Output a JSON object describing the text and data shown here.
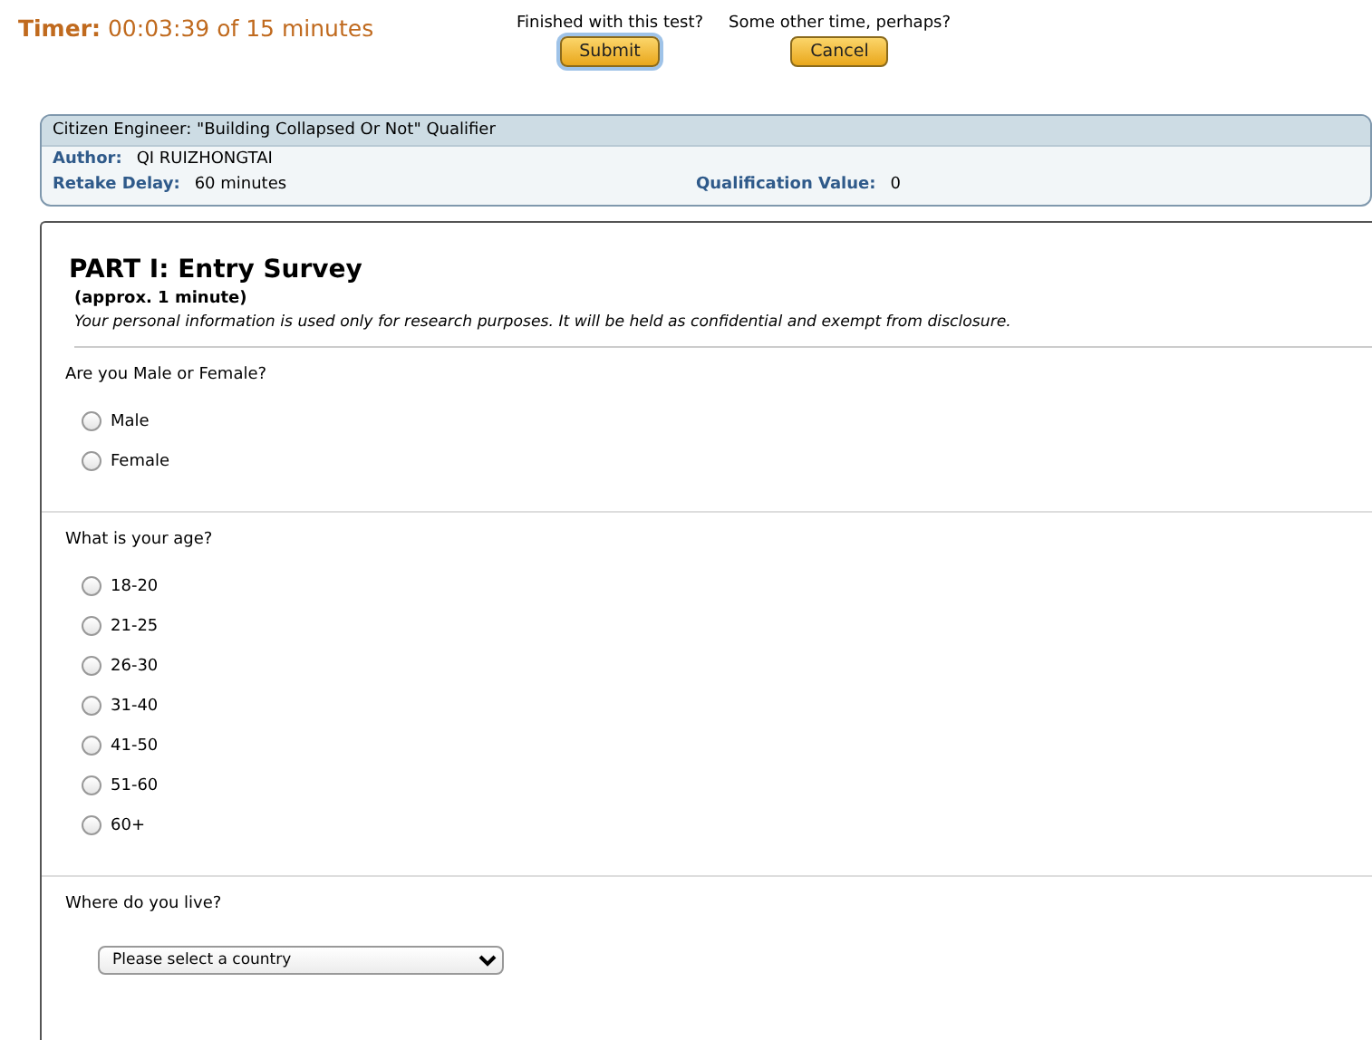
{
  "timer": {
    "label": "Timer:",
    "value": "00:03:39 of 15 minutes"
  },
  "actions": [
    {
      "prompt": "Finished with this test?",
      "button": "Submit",
      "focused": true
    },
    {
      "prompt": "Some other time, perhaps?",
      "button": "Cancel",
      "focused": false
    }
  ],
  "info": {
    "title": "Citizen Engineer: \"Building Collapsed Or Not\" Qualifier",
    "author_label": "Author:",
    "author": "QI RUIZHONGTAI",
    "delay_label": "Retake Delay:",
    "delay": "60 minutes",
    "value_label": "Qualification Value:",
    "value": "0"
  },
  "part": {
    "title": "PART I: Entry Survey",
    "duration": "(approx. 1 minute)",
    "note": "Your personal information is used only for research purposes. It will be held as confidential and exempt from disclosure."
  },
  "questions": [
    {
      "kind": "radio",
      "text": "Are you Male or Female?",
      "options": [
        {
          "label": "Male",
          "selected": false
        },
        {
          "label": "Female",
          "selected": false
        }
      ]
    },
    {
      "kind": "radio",
      "text": "What is your age?",
      "options": [
        {
          "label": "18-20",
          "selected": false
        },
        {
          "label": "21-25",
          "selected": false
        },
        {
          "label": "26-30",
          "selected": false
        },
        {
          "label": "31-40",
          "selected": false
        },
        {
          "label": "41-50",
          "selected": false
        },
        {
          "label": "51-60",
          "selected": false
        },
        {
          "label": "60+",
          "selected": false
        }
      ]
    },
    {
      "kind": "select",
      "text": "Where do you live?",
      "value": "Please select a country"
    }
  ]
}
